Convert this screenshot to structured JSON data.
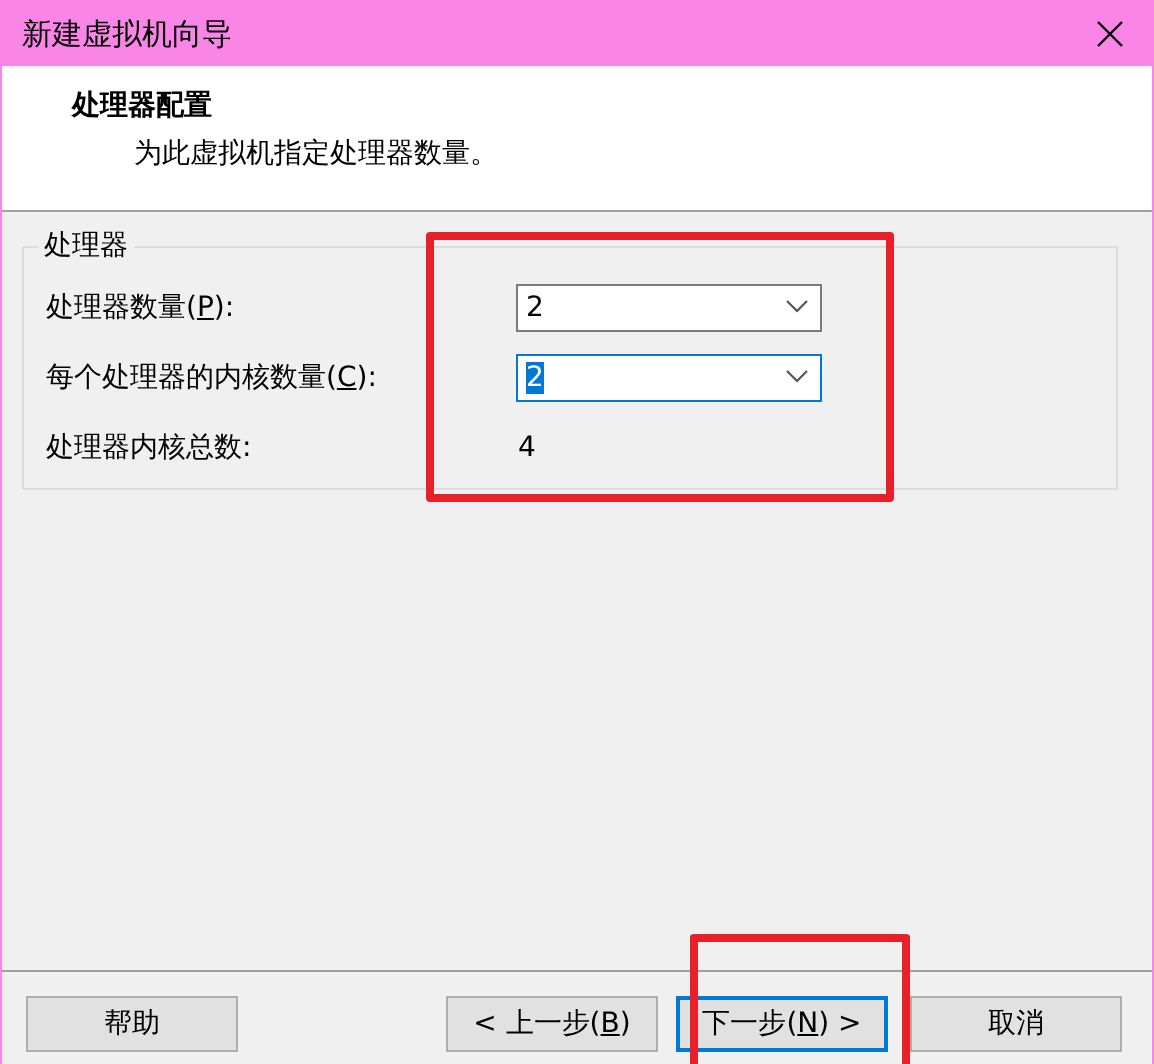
{
  "window": {
    "title": "新建虚拟机向导"
  },
  "header": {
    "title": "处理器配置",
    "subtitle": "为此虚拟机指定处理器数量。"
  },
  "group": {
    "title": "处理器",
    "highlighted": true,
    "rows": [
      {
        "kind": "combo",
        "label": "处理器数量(",
        "mnemonic": "P",
        "label_end": "):",
        "value": "2",
        "focused": false
      },
      {
        "kind": "combo",
        "label": "每个处理器的内核数量(",
        "mnemonic": "C",
        "label_end": "):",
        "value": "2",
        "focused": true
      },
      {
        "kind": "readout",
        "label": "处理器内核总数:",
        "value": "4"
      }
    ]
  },
  "buttons": [
    {
      "label": "帮助",
      "focused": false,
      "highlighted": false
    },
    {
      "label": "< 上一步(",
      "mnemonic": "B",
      "label_end": ")",
      "focused": false,
      "highlighted": false
    },
    {
      "label": "下一步(",
      "mnemonic": "N",
      "label_end": ") >",
      "focused": true,
      "highlighted": true
    },
    {
      "label": "取消",
      "focused": false,
      "highlighted": false
    }
  ]
}
